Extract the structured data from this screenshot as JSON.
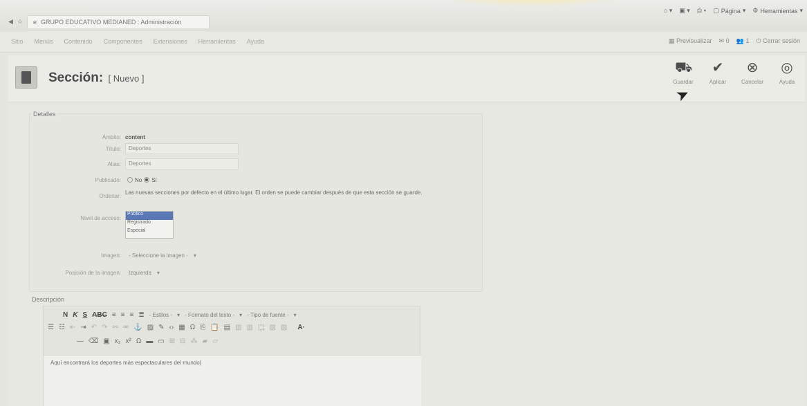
{
  "browser": {
    "tab_title": "GRUPO EDUCATIVO MEDIANED : Administración",
    "tools": {
      "page": "Página",
      "tools": "Herramientas"
    }
  },
  "admin_menu": {
    "items": [
      "Sitio",
      "Menús",
      "Contenido",
      "Componentes",
      "Extensiones",
      "Herramientas",
      "Ayuda"
    ],
    "right": {
      "preview": "Previsualizar",
      "messages": "0",
      "users": "1",
      "logout": "Cerrar sesión"
    }
  },
  "header": {
    "title": "Sección:",
    "subtitle": "[ Nuevo ]"
  },
  "toolbar": {
    "save": "Guardar",
    "apply": "Aplicar",
    "cancel": "Cancelar",
    "help": "Ayuda"
  },
  "details": {
    "legend": "Detalles",
    "scope_label": "Ámbito:",
    "scope_value": "content",
    "title_label": "Título:",
    "title_value": "Deportes",
    "alias_label": "Alias:",
    "alias_value": "Deportes",
    "published_label": "Publicado:",
    "published_no": "No",
    "published_yes": "Sí",
    "order_label": "Ordenar:",
    "order_text": "Las nuevas secciones por defecto en el último lugar. El orden se puede cambiar después de que esta sección se guarde.",
    "access_label": "Nivel de acceso:",
    "access_options": [
      "Público",
      "Registrado",
      "Especial"
    ],
    "image_label": "Imagen:",
    "image_value": "- Seleccione la imagen -",
    "image_pos_label": "Posición de la imagen:",
    "image_pos_value": "Izquierda"
  },
  "description": {
    "legend": "Descripción",
    "styles": "- Estilos -",
    "format": "- Formato del texto -",
    "font": "- Tipo de fuente -",
    "content": "Aquí encontrará los deportes más espectaculares del mundo"
  }
}
